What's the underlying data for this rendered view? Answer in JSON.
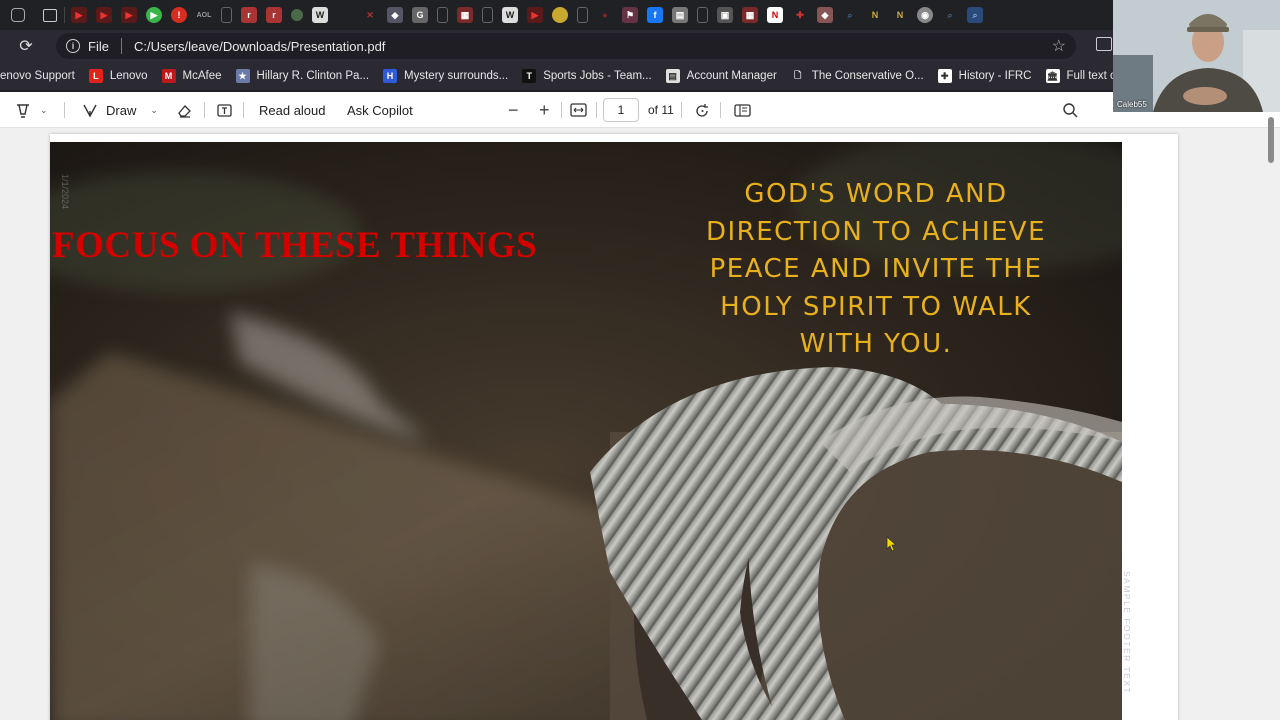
{
  "address": {
    "scheme": "File",
    "path": "C:/Users/leave/Downloads/Presentation.pdf"
  },
  "bookmarks": [
    {
      "label": "enovo Support",
      "icon": "blank-icon",
      "color": "#2b2a33"
    },
    {
      "label": "Lenovo",
      "icon": "lenovo-icon",
      "color": "#e2231a",
      "glyph": "L"
    },
    {
      "label": "McAfee",
      "icon": "mcafee-icon",
      "color": "#c01818",
      "glyph": "M"
    },
    {
      "label": "Hillary R. Clinton Pa...",
      "icon": "seal-icon",
      "color": "#6b7aa8",
      "glyph": "★"
    },
    {
      "label": "Mystery surrounds...",
      "icon": "h-icon",
      "color": "#2f5bd8",
      "glyph": "H"
    },
    {
      "label": "Sports Jobs - Team...",
      "icon": "t-icon",
      "color": "#111111",
      "glyph": "T"
    },
    {
      "label": "Account Manager",
      "icon": "page-icon",
      "color": "#e0e0e0",
      "glyph": "▤"
    },
    {
      "label": "The Conservative O...",
      "icon": "document-icon",
      "color": "#2b2a33",
      "glyph": "🗋"
    },
    {
      "label": "History - IFRC",
      "icon": "ifrc-icon",
      "color": "#ffffff",
      "glyph": "✚"
    },
    {
      "label": "Full text of \"EL The...",
      "icon": "archive-icon",
      "color": "#ffffff",
      "glyph": "🏛"
    }
  ],
  "toolbar": {
    "draw_label": "Draw",
    "read_aloud_label": "Read aloud",
    "ask_copilot_label": "Ask Copilot",
    "page_current": "1",
    "page_total": "of 11"
  },
  "slide": {
    "title": "FOCUS ON THESE THINGS",
    "body_lines": [
      "GOD'S WORD AND",
      "DIRECTION TO ACHIEVE",
      "PEACE AND INVITE THE",
      "HOLY SPIRIT TO WALK",
      "WITH YOU."
    ],
    "date": "1/1/2024",
    "footer": "SAMPLE FOOTER TEXT",
    "title_color": "#d40000",
    "body_color": "#e8b11c"
  },
  "webcam": {
    "label": "Caleb55"
  }
}
